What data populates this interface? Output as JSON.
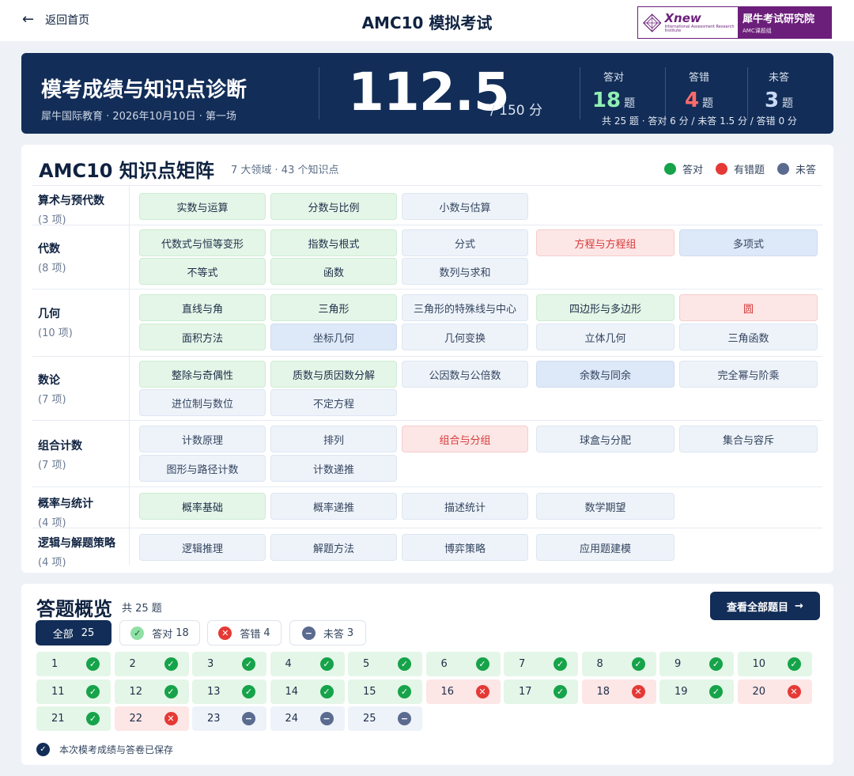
{
  "header": {
    "back_label": "返回首页",
    "title": "AMC10 模拟考试",
    "brand": {
      "name": "Xnew",
      "subtitle": "International Assessment Research Institute",
      "cn_name": "犀牛考试研究院",
      "small": "AMC课题组"
    }
  },
  "banner": {
    "title": "模考成绩与知识点诊断",
    "meta": "犀牛国际教育 · 2026年10月10日 · 第一场",
    "score": "112.5",
    "score_total": "/ 150 分",
    "stats": [
      {
        "label": "答对",
        "value": "18",
        "unit": "题"
      },
      {
        "label": "答错",
        "value": "4",
        "unit": "题"
      },
      {
        "label": "未答",
        "value": "3",
        "unit": "题"
      }
    ],
    "rules": "共 25 题 · 答对 6 分 / 未答 1.5 分 / 答错 0 分"
  },
  "matrix": {
    "title": "AMC10 知识点矩阵",
    "subtitle": "7 大领域 · 43 个知识点",
    "legend": {
      "correct": "答对",
      "wrong": "有错题",
      "unanswered": "未答"
    },
    "categories": [
      {
        "name": "算术与预代数",
        "count": "(3 项)",
        "rows": [
          [
            {
              "label": "实数与运算",
              "status": "correct"
            },
            {
              "label": "分数与比例",
              "status": "correct"
            },
            {
              "label": "小数与估算",
              "status": "unans"
            }
          ]
        ]
      },
      {
        "name": "代数",
        "count": "(8 项)",
        "rows": [
          [
            {
              "label": "代数式与恒等变形",
              "status": "correct"
            },
            {
              "label": "指数与根式",
              "status": "correct"
            },
            {
              "label": "分式",
              "status": "unans"
            },
            {
              "label": "方程与方程组",
              "status": "wrong"
            },
            {
              "label": "多项式",
              "status": "partial"
            }
          ],
          [
            {
              "label": "不等式",
              "status": "correct"
            },
            {
              "label": "函数",
              "status": "correct"
            },
            {
              "label": "数列与求和",
              "status": "unans"
            }
          ]
        ]
      },
      {
        "name": "几何",
        "count": "(10 项)",
        "rows": [
          [
            {
              "label": "直线与角",
              "status": "correct"
            },
            {
              "label": "三角形",
              "status": "correct"
            },
            {
              "label": "三角形的特殊线与中心",
              "status": "unans"
            },
            {
              "label": "四边形与多边形",
              "status": "correct"
            },
            {
              "label": "圆",
              "status": "wrong"
            }
          ],
          [
            {
              "label": "面积方法",
              "status": "correct"
            },
            {
              "label": "坐标几何",
              "status": "partial"
            },
            {
              "label": "几何变换",
              "status": "unans"
            },
            {
              "label": "立体几何",
              "status": "unans"
            },
            {
              "label": "三角函数",
              "status": "unans"
            }
          ]
        ]
      },
      {
        "name": "数论",
        "count": "(7 项)",
        "rows": [
          [
            {
              "label": "整除与奇偶性",
              "status": "correct"
            },
            {
              "label": "质数与质因数分解",
              "status": "correct"
            },
            {
              "label": "公因数与公倍数",
              "status": "unans"
            },
            {
              "label": "余数与同余",
              "status": "partial"
            },
            {
              "label": "完全幂与阶乘",
              "status": "unans"
            }
          ],
          [
            {
              "label": "进位制与数位",
              "status": "unans"
            },
            {
              "label": "不定方程",
              "status": "unans"
            }
          ]
        ]
      },
      {
        "name": "组合计数",
        "count": "(7 项)",
        "rows": [
          [
            {
              "label": "计数原理",
              "status": "unans"
            },
            {
              "label": "排列",
              "status": "unans"
            },
            {
              "label": "组合与分组",
              "status": "wrong"
            },
            {
              "label": "球盒与分配",
              "status": "unans"
            },
            {
              "label": "集合与容斥",
              "status": "unans"
            }
          ],
          [
            {
              "label": "图形与路径计数",
              "status": "unans"
            },
            {
              "label": "计数递推",
              "status": "unans"
            }
          ]
        ]
      },
      {
        "name": "概率与统计",
        "count": "(4 项)",
        "rows": [
          [
            {
              "label": "概率基础",
              "status": "correct"
            },
            {
              "label": "概率递推",
              "status": "unans"
            },
            {
              "label": "描述统计",
              "status": "unans"
            },
            {
              "label": "数学期望",
              "status": "unans"
            }
          ]
        ]
      },
      {
        "name": "逻辑与解题策略",
        "count": "(4 项)",
        "rows": [
          [
            {
              "label": "逻辑推理",
              "status": "unans"
            },
            {
              "label": "解题方法",
              "status": "unans"
            },
            {
              "label": "博弈策略",
              "status": "unans"
            },
            {
              "label": "应用题建模",
              "status": "unans"
            }
          ]
        ]
      }
    ]
  },
  "answers": {
    "title": "答题概览",
    "count": "共 25 题",
    "view_all": "查看全部题目",
    "filters": [
      {
        "label": "全部",
        "count": "25"
      },
      {
        "label": "答对",
        "count": "18"
      },
      {
        "label": "答错",
        "count": "4"
      },
      {
        "label": "未答",
        "count": "3"
      }
    ],
    "questions": [
      {
        "n": "1",
        "s": "correct"
      },
      {
        "n": "2",
        "s": "correct"
      },
      {
        "n": "3",
        "s": "correct"
      },
      {
        "n": "4",
        "s": "correct"
      },
      {
        "n": "5",
        "s": "correct"
      },
      {
        "n": "6",
        "s": "correct"
      },
      {
        "n": "7",
        "s": "correct"
      },
      {
        "n": "8",
        "s": "correct"
      },
      {
        "n": "9",
        "s": "correct"
      },
      {
        "n": "10",
        "s": "correct"
      },
      {
        "n": "11",
        "s": "correct"
      },
      {
        "n": "12",
        "s": "correct"
      },
      {
        "n": "13",
        "s": "correct"
      },
      {
        "n": "14",
        "s": "correct"
      },
      {
        "n": "15",
        "s": "correct"
      },
      {
        "n": "16",
        "s": "wrong"
      },
      {
        "n": "17",
        "s": "correct"
      },
      {
        "n": "18",
        "s": "wrong"
      },
      {
        "n": "19",
        "s": "correct"
      },
      {
        "n": "20",
        "s": "wrong"
      },
      {
        "n": "21",
        "s": "correct"
      },
      {
        "n": "22",
        "s": "wrong"
      },
      {
        "n": "23",
        "s": "unans"
      },
      {
        "n": "24",
        "s": "unans"
      },
      {
        "n": "25",
        "s": "unans"
      }
    ],
    "saved_text": "本次模考成绩与答卷已保存"
  },
  "colors": {
    "navy": "#122d57",
    "correct": "#16a34a",
    "wrong": "#e53935",
    "unanswered": "#5a6b8f",
    "brand": "#6b1f7a"
  },
  "icons": [
    "back-arrow-icon",
    "check-circle-icon",
    "x-circle-icon",
    "minus-circle-icon",
    "arrow-right-icon"
  ]
}
